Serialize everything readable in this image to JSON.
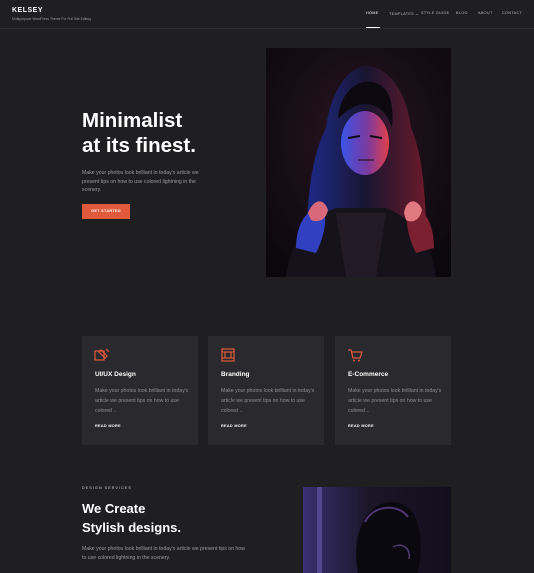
{
  "brand": {
    "name": "KELSEY",
    "tagline": "Multipurpose WordPress Theme For Full Site Editing"
  },
  "nav": {
    "items": [
      "HOME",
      "TEMPLATES",
      "STYLE GUIDE",
      "BLOG",
      "ABOUT",
      "CONTACT"
    ],
    "templates_arrow": "⌄",
    "active": "HOME"
  },
  "hero": {
    "title_line1": "Minimalist",
    "title_line2": "at its finest.",
    "text": "Make your photos look brilliant in today's article we present tips on how to use colored lightning in the scenery.",
    "button": "GET STARTED"
  },
  "cards": [
    {
      "icon": "design-tools-icon",
      "title": "UI/UX Design",
      "text": "Make your photos look brilliant in today's article we present tips on how to use colored ..",
      "link": "READ MORE"
    },
    {
      "icon": "branding-icon",
      "title": "Branding",
      "text": "Make your photos look brilliant in today's article we present tips on how to use colored ..",
      "link": "READ MORE"
    },
    {
      "icon": "shopping-cart-icon",
      "title": "E-Commerce",
      "text": "Make your photos look brilliant in today's article we present tips on how to use colored ..",
      "link": "READ MORE"
    }
  ],
  "services": {
    "eyebrow": "DESIGN SERVICES",
    "title_line1": "We Create",
    "title_line2": "Stylish designs.",
    "text": "Make your photos look brilliant in today's article we present tips on how to use colored lightning in the scenery."
  },
  "colors": {
    "background": "#1f1f22",
    "card": "#2a2a2e",
    "accent": "#e05a3b"
  }
}
